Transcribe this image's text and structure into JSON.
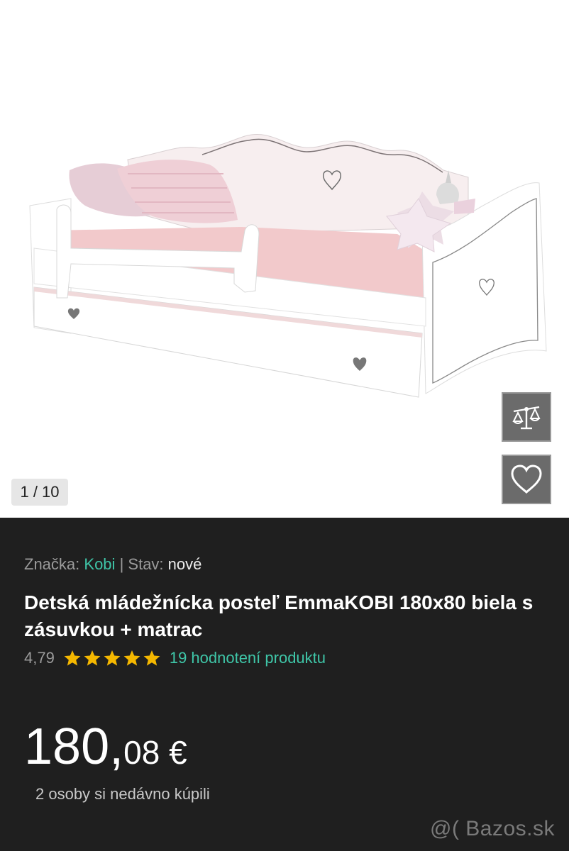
{
  "gallery": {
    "counter": "1 / 10",
    "compare_icon": "scales-icon",
    "favorite_icon": "heart-icon"
  },
  "product": {
    "brand_label": "Značka:",
    "brand_value": "Kobi",
    "separator": "|",
    "condition_label": "Stav:",
    "condition_value": "nové",
    "title": "Detská mládežnícka posteľ EmmaKOBI 180x80 biela s zásuvkou + matrac",
    "rating_value": "4,79",
    "rating_stars": 5,
    "rating_link": "19 hodnotení produktu",
    "price_integer": "180,",
    "price_decimal": "08 €",
    "recent_buyers": "2 osoby si nedávno kúpili"
  },
  "colors": {
    "accent": "#3fc6a8",
    "star": "#f5b800",
    "background": "#1f1f1f"
  },
  "watermark": "@( Bazos.sk"
}
